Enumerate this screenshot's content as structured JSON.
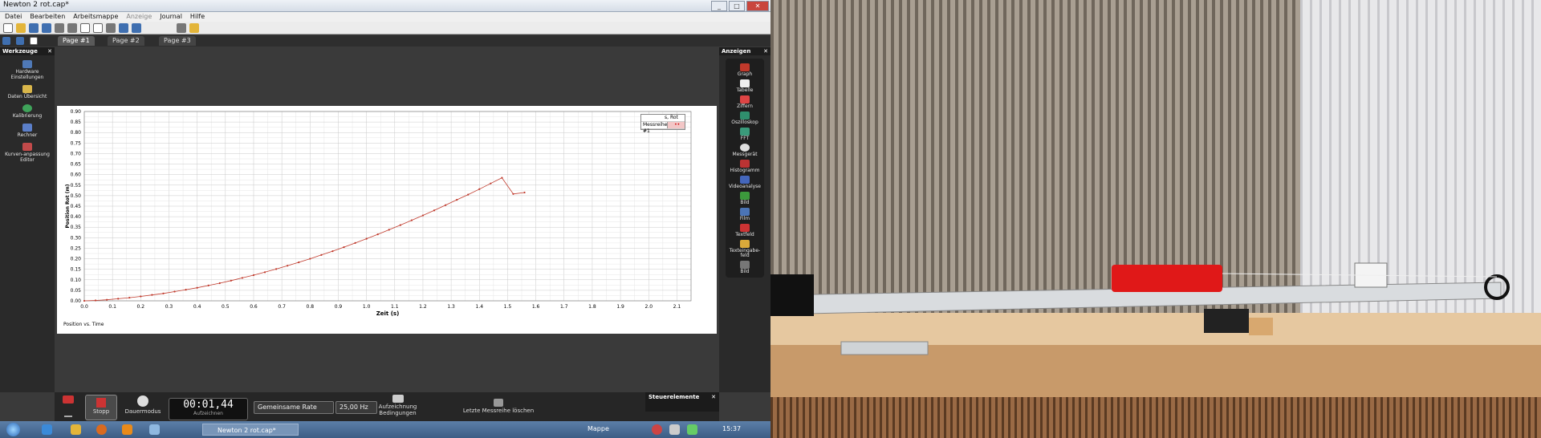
{
  "window": {
    "title": "Newton 2 rot.cap*",
    "controls": [
      "_",
      "□",
      "✕"
    ]
  },
  "menu": [
    "Datei",
    "Bearbeiten",
    "Arbeitsmappe",
    "Anzeige",
    "Journal",
    "Hilfe"
  ],
  "tabs": [
    "Page #1",
    "Page #2",
    "Page #3"
  ],
  "left_panel": {
    "title": "Werkzeuge",
    "close": "✕",
    "items": [
      "Hardware Einstellungen",
      "Daten Übersicht",
      "Kalibrierung",
      "Rechner",
      "Kurven-anpassung Editor"
    ]
  },
  "right_panel": {
    "title": "Anzeigen",
    "close": "✕",
    "items": [
      "Graph",
      "Tabelle",
      "Ziffern",
      "Oszilloskop",
      "FFT",
      "Messgerät",
      "Histogramm",
      "Videoanalyse",
      "Bild",
      "Film",
      "Textfeld",
      "Texteingabe-feld",
      "Bild"
    ]
  },
  "chart_data": {
    "type": "line",
    "title": "Position vs. Time",
    "xlabel": "Zeit (s)",
    "ylabel": "Position Rot (m)",
    "xlim": [
      0,
      2.15
    ],
    "ylim": [
      0,
      0.9
    ],
    "xticks": [
      "0.0",
      "0.1",
      "0.2",
      "0.3",
      "0.4",
      "0.5",
      "0.6",
      "0.7",
      "0.8",
      "0.9",
      "1.0",
      "1.1",
      "1.2",
      "1.3",
      "1.4",
      "1.5",
      "1.6",
      "1.7",
      "1.8",
      "1.9",
      "2.0",
      "2.1"
    ],
    "yticks": [
      "0.00",
      "0.05",
      "0.10",
      "0.15",
      "0.20",
      "0.25",
      "0.30",
      "0.35",
      "0.40",
      "0.45",
      "0.50",
      "0.55",
      "0.60",
      "0.65",
      "0.70",
      "0.75",
      "0.80",
      "0.85",
      "0.90"
    ],
    "grid": true,
    "legend_placement": "top-right",
    "legend": {
      "header": "s, Rot",
      "series_label": "Messreihe #1",
      "marker": "••"
    },
    "series": [
      {
        "name": "s, Rot",
        "color": "#c0392b",
        "x": [
          0.0,
          0.04,
          0.08,
          0.12,
          0.16,
          0.2,
          0.24,
          0.28,
          0.32,
          0.36,
          0.4,
          0.44,
          0.48,
          0.52,
          0.56,
          0.6,
          0.64,
          0.68,
          0.72,
          0.76,
          0.8,
          0.84,
          0.88,
          0.92,
          0.96,
          1.0,
          1.04,
          1.08,
          1.12,
          1.16,
          1.2,
          1.24,
          1.28,
          1.32,
          1.36,
          1.4,
          1.44,
          1.48,
          1.52,
          1.56
        ],
        "y": [
          0.0,
          0.002,
          0.005,
          0.01,
          0.015,
          0.021,
          0.028,
          0.035,
          0.044,
          0.053,
          0.062,
          0.073,
          0.084,
          0.096,
          0.109,
          0.122,
          0.136,
          0.151,
          0.167,
          0.183,
          0.2,
          0.218,
          0.236,
          0.255,
          0.275,
          0.295,
          0.316,
          0.338,
          0.36,
          0.383,
          0.406,
          0.43,
          0.455,
          0.48,
          0.505,
          0.531,
          0.558,
          0.585,
          0.508,
          0.515
        ]
      }
    ]
  },
  "bottom": {
    "stop_label": "Stopp",
    "mode_label": "Dauermodus",
    "timer_value": "00:01,44",
    "timer_label": "Aufzeichnen",
    "rate_select": "Gemeinsame Rate",
    "rate_value": "25,00 Hz",
    "conditions_label": "Aufzeichnung Bedingungen",
    "delete_label": "Letzte Messreihe löschen",
    "steuer_title": "Steuerelemente"
  },
  "taskbar": {
    "active_item": "Newton 2 rot.cap*",
    "tray_label": "Mappe",
    "clock": "15:37"
  }
}
